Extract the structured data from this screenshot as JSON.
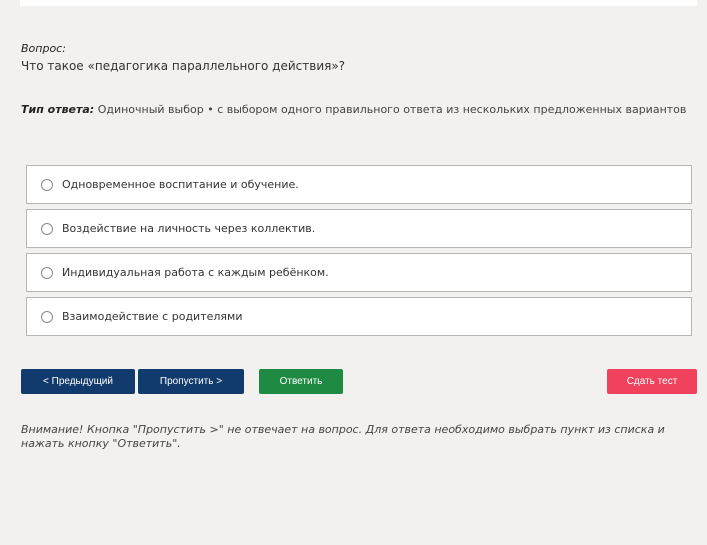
{
  "question": {
    "label": "Вопрос:",
    "text": "Что такое «педагогика параллельного действия»?"
  },
  "answer_type": {
    "label": "Тип ответа:",
    "value": "Одиночный выбор • с выбором одного правильного ответа из нескольких предложенных вариантов"
  },
  "options": [
    {
      "label": "Одновременное воспитание и обучение."
    },
    {
      "label": "Воздействие на личность через коллектив."
    },
    {
      "label": "Индивидуальная работа с каждым ребёнком."
    },
    {
      "label": "Взаимодействие с родителями"
    }
  ],
  "buttons": {
    "prev": "< Предыдущий",
    "skip": "Пропустить >",
    "answer": "Ответить",
    "submit": "Сдать тест"
  },
  "colors": {
    "nav_button": "#123b6d",
    "answer_button": "#1e8a42",
    "submit_button": "#f0425c"
  },
  "warning": "Внимание! Кнопка \"Пропустить >\" не отвечает на вопрос. Для ответа необходимо выбрать пункт из списка и нажать кнопку \"Ответить\"."
}
